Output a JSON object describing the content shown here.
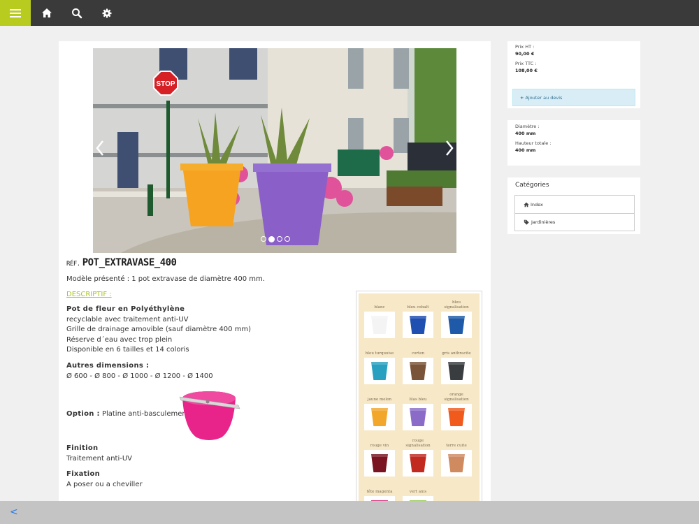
{
  "toolbar": {
    "menu_icon": "menu-icon",
    "home_icon": "home-icon",
    "search_icon": "search-icon",
    "settings_icon": "gear-icon",
    "accent": "#b8cc1f"
  },
  "product": {
    "ref_prefix": "RÉF.",
    "ref_code": "POT_EXTRAVASE_400",
    "model_text": "Modèle présenté : 1 pot extravase de diamètre 400 mm.",
    "desc_link": "DESCRIPTIF :",
    "heading": "Pot de fleur en Polyéthylène",
    "features": [
      "recyclable avec traitement anti-UV",
      "Grille de drainage amovible (sauf diamètre 400 mm)",
      "Réserve d´eau avec trop plein",
      "Disponible en 6 tailles et 14 coloris"
    ],
    "dims_title": "Autres dimensions :",
    "dims_value": "Ø 600 - Ø 800 - Ø 1000 - Ø 1200 - Ø 1400",
    "option_label": "Option :",
    "option_value": "Platine anti-basculement",
    "finition_title": "Finition",
    "finition_value": "Traitement anti-UV",
    "fixation_title": "Fixation",
    "fixation_value": "A poser ou a cheviller",
    "photo_sign": "STOP",
    "slider_dots_count": 4,
    "slider_active_dot": 2
  },
  "colors": [
    {
      "name": "blanc",
      "hex": "#f4f4f4"
    },
    {
      "name": "bleu cobalt",
      "hex": "#1f4fb0"
    },
    {
      "name": "bleu signalisation",
      "hex": "#1e5aa8"
    },
    {
      "name": "bleu turquoise",
      "hex": "#2aa0c0"
    },
    {
      "name": "corten",
      "hex": "#7a5438"
    },
    {
      "name": "gris anthracite",
      "hex": "#3a3d40"
    },
    {
      "name": "jaune melon",
      "hex": "#f2a72a"
    },
    {
      "name": "lilas bleu",
      "hex": "#8a6cc8"
    },
    {
      "name": "orange signalisation",
      "hex": "#f05a1c"
    },
    {
      "name": "rouge vin",
      "hex": "#7a1420"
    },
    {
      "name": "rouge signalisation",
      "hex": "#c22a20"
    },
    {
      "name": "terre cuite",
      "hex": "#d08a60"
    },
    {
      "name": "tête magenta",
      "hex": "#d0146c"
    },
    {
      "name": "vert anis",
      "hex": "#8cc63f"
    }
  ],
  "pricing": {
    "ht_label": "Prix HT :",
    "ht_value": "90,00 €",
    "ttc_label": "Prix TTC :",
    "ttc_value": "108,00 €",
    "devis_label": "Ajouter au devis"
  },
  "specs": {
    "diam_label": "Diamètre :",
    "diam_value": "400 mm",
    "height_label": "Hauteur totale :",
    "height_value": "400 mm"
  },
  "categories": {
    "title": "Catégories",
    "items": [
      {
        "label": "Index",
        "icon": "home-icon"
      },
      {
        "label": "Jardinières",
        "icon": "tag-icon"
      }
    ]
  },
  "bottom": {
    "back_label": "<"
  }
}
